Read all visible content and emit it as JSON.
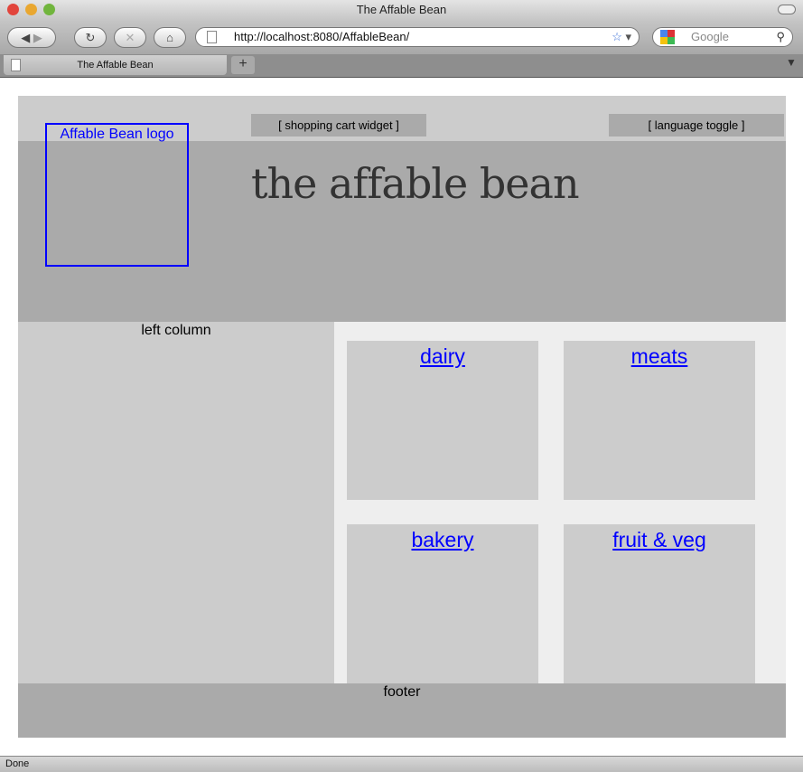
{
  "browser": {
    "window_title": "The Affable Bean",
    "url": "http://localhost:8080/AffableBean/",
    "search_placeholder": "Google",
    "tab_title": "The Affable Bean",
    "new_tab": "+",
    "status": "Done"
  },
  "page": {
    "logo_text": "Affable Bean logo",
    "cart_widget": "[ shopping cart widget ]",
    "language_toggle": "[ language toggle ]",
    "brand": "the affable bean",
    "left_column": "left column",
    "categories": [
      {
        "label": "dairy"
      },
      {
        "label": "meats"
      },
      {
        "label": "bakery"
      },
      {
        "label": "fruit & veg"
      }
    ],
    "footer": "footer"
  },
  "colors": {
    "link": "#0000ff",
    "header": "#aaaaaa",
    "panel": "#cccccc",
    "main_bg": "#eeeeee"
  }
}
